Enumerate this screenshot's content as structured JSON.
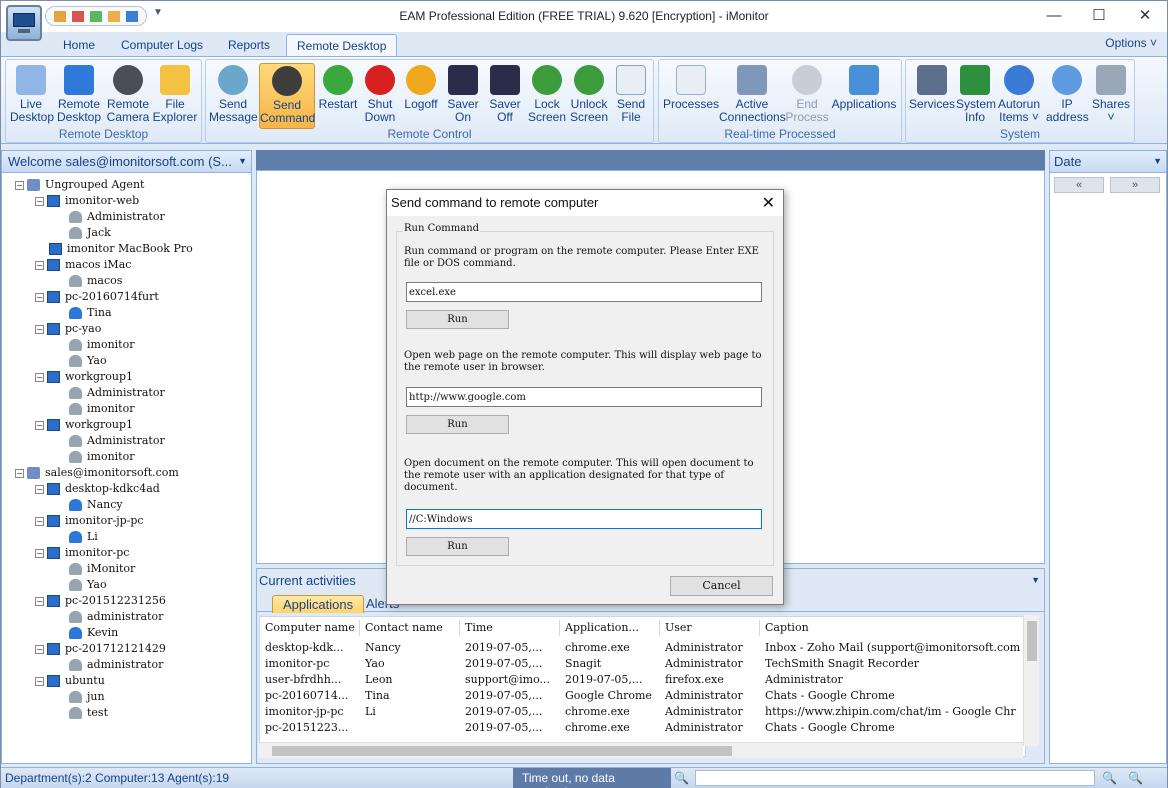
{
  "window": {
    "title": "EAM Professional Edition (FREE TRIAL) 9.620 [Encryption] - iMonitor",
    "minimize": "—",
    "maximize": "☐",
    "close": "✕"
  },
  "menu_tabs": [
    "Home",
    "Computer Logs",
    "Reports",
    "Remote Desktop"
  ],
  "options_label": "Options ˅",
  "ribbon": {
    "remote_desktop": {
      "label": "Remote Desktop",
      "buttons": [
        {
          "line1": "Live",
          "line2": "Desktop"
        },
        {
          "line1": "Remote",
          "line2": "Desktop"
        },
        {
          "line1": "Remote",
          "line2": "Camera"
        },
        {
          "line1": "File",
          "line2": "Explorer"
        }
      ]
    },
    "remote_control": {
      "label": "Remote Control",
      "buttons": [
        {
          "line1": "Send",
          "line2": "Message"
        },
        {
          "line1": "Send",
          "line2": "Command"
        },
        {
          "line1": "Restart",
          "line2": ""
        },
        {
          "line1": "Shut",
          "line2": "Down"
        },
        {
          "line1": "Logoff",
          "line2": ""
        },
        {
          "line1": "Saver",
          "line2": "On"
        },
        {
          "line1": "Saver",
          "line2": "Off"
        },
        {
          "line1": "Lock",
          "line2": "Screen"
        },
        {
          "line1": "Unlock",
          "line2": "Screen"
        },
        {
          "line1": "Send",
          "line2": "File"
        }
      ]
    },
    "realtime": {
      "label": "Real-time Processed",
      "buttons": [
        {
          "line1": "Processes",
          "line2": ""
        },
        {
          "line1": "Active",
          "line2": "Connections"
        },
        {
          "line1": "End",
          "line2": "Process"
        },
        {
          "line1": "Applications",
          "line2": ""
        }
      ]
    },
    "system": {
      "label": "System",
      "buttons": [
        {
          "line1": "Services",
          "line2": ""
        },
        {
          "line1": "System",
          "line2": "Info"
        },
        {
          "line1": "Autorun",
          "line2": "Items ˅"
        },
        {
          "line1": "IP",
          "line2": "address"
        },
        {
          "line1": "Shares",
          "line2": "˅"
        }
      ]
    }
  },
  "left_panel": {
    "header": "Welcome sales@imonitorsoft.com (S...",
    "tree": [
      "Ungrouped Agent",
      "imonitor-web",
      "Administrator",
      "Jack",
      "imonitor MacBook Pro",
      "macos iMac",
      "macos",
      "pc-20160714furt",
      "Tina",
      "pc-yao",
      "imonitor",
      "Yao",
      "workgroup1",
      "Administrator",
      "imonitor",
      "workgroup1",
      "Administrator",
      "imonitor",
      "sales@imonitorsoft.com",
      "desktop-kdkc4ad",
      "Nancy",
      "imonitor-jp-pc",
      "Li",
      "imonitor-pc",
      "iMonitor",
      "Yao",
      "pc-201512231256",
      "administrator",
      "Kevin",
      "pc-201712121429",
      "administrator",
      "ubuntu",
      "jun",
      "test"
    ]
  },
  "activities": {
    "header": "Current activities",
    "tabs": [
      "Applications",
      "Alerts"
    ],
    "columns": [
      "Computer name",
      "Contact name",
      "Time",
      "Application...",
      "User",
      "Caption"
    ],
    "rows": [
      [
        "desktop-kdk...",
        "Nancy",
        "2019-07-05,...",
        "chrome.exe",
        "Administrator",
        "Inbox - Zoho Mail (support@imonitorsoft.com"
      ],
      [
        "imonitor-pc",
        "Yao",
        "2019-07-05,...",
        "Snagit",
        "Administrator",
        "TechSmith Snagit Recorder"
      ],
      [
        "user-bfrdhh...",
        "Leon",
        "support@imo...",
        "2019-07-05,...",
        "firefox.exe",
        "Administrator"
      ],
      [
        "pc-20160714...",
        "Tina",
        "2019-07-05,...",
        "Google Chrome",
        "Administrator",
        "Chats - Google Chrome"
      ],
      [
        "imonitor-jp-pc",
        "Li",
        "2019-07-05,...",
        "chrome.exe",
        "Administrator",
        "https://www.zhipin.com/chat/im - Google Chr"
      ],
      [
        "pc-20151223...",
        "",
        "2019-07-05,...",
        "chrome.exe",
        "Administrator",
        "Chats - Google Chrome"
      ]
    ]
  },
  "right_panel": {
    "header": "Date",
    "prev": "«",
    "next": "»"
  },
  "status": {
    "left": "Department(s):2  Computer:13  Agent(s):19",
    "middle": "Time out, no data received"
  },
  "dialog": {
    "title": "Send command to remote computer",
    "group_label": "Run Command",
    "cmd_text": "Run command or program on the remote computer. Please Enter EXE file or DOS command.",
    "cmd_value": "excel.exe",
    "web_text": "Open web page on the remote computer. This will display web page to the remote user in browser.",
    "web_value": "http://www.google.com",
    "doc_text": "Open document on the remote computer. This will open document to the remote user with an application designated for that type of document.",
    "doc_value": "//C:Windows",
    "run_label": "Run",
    "cancel_label": "Cancel"
  },
  "colors": {
    "accent": "#15428b",
    "ribbon_selected": "#f7b546",
    "panel_border": "#8db2e3"
  }
}
